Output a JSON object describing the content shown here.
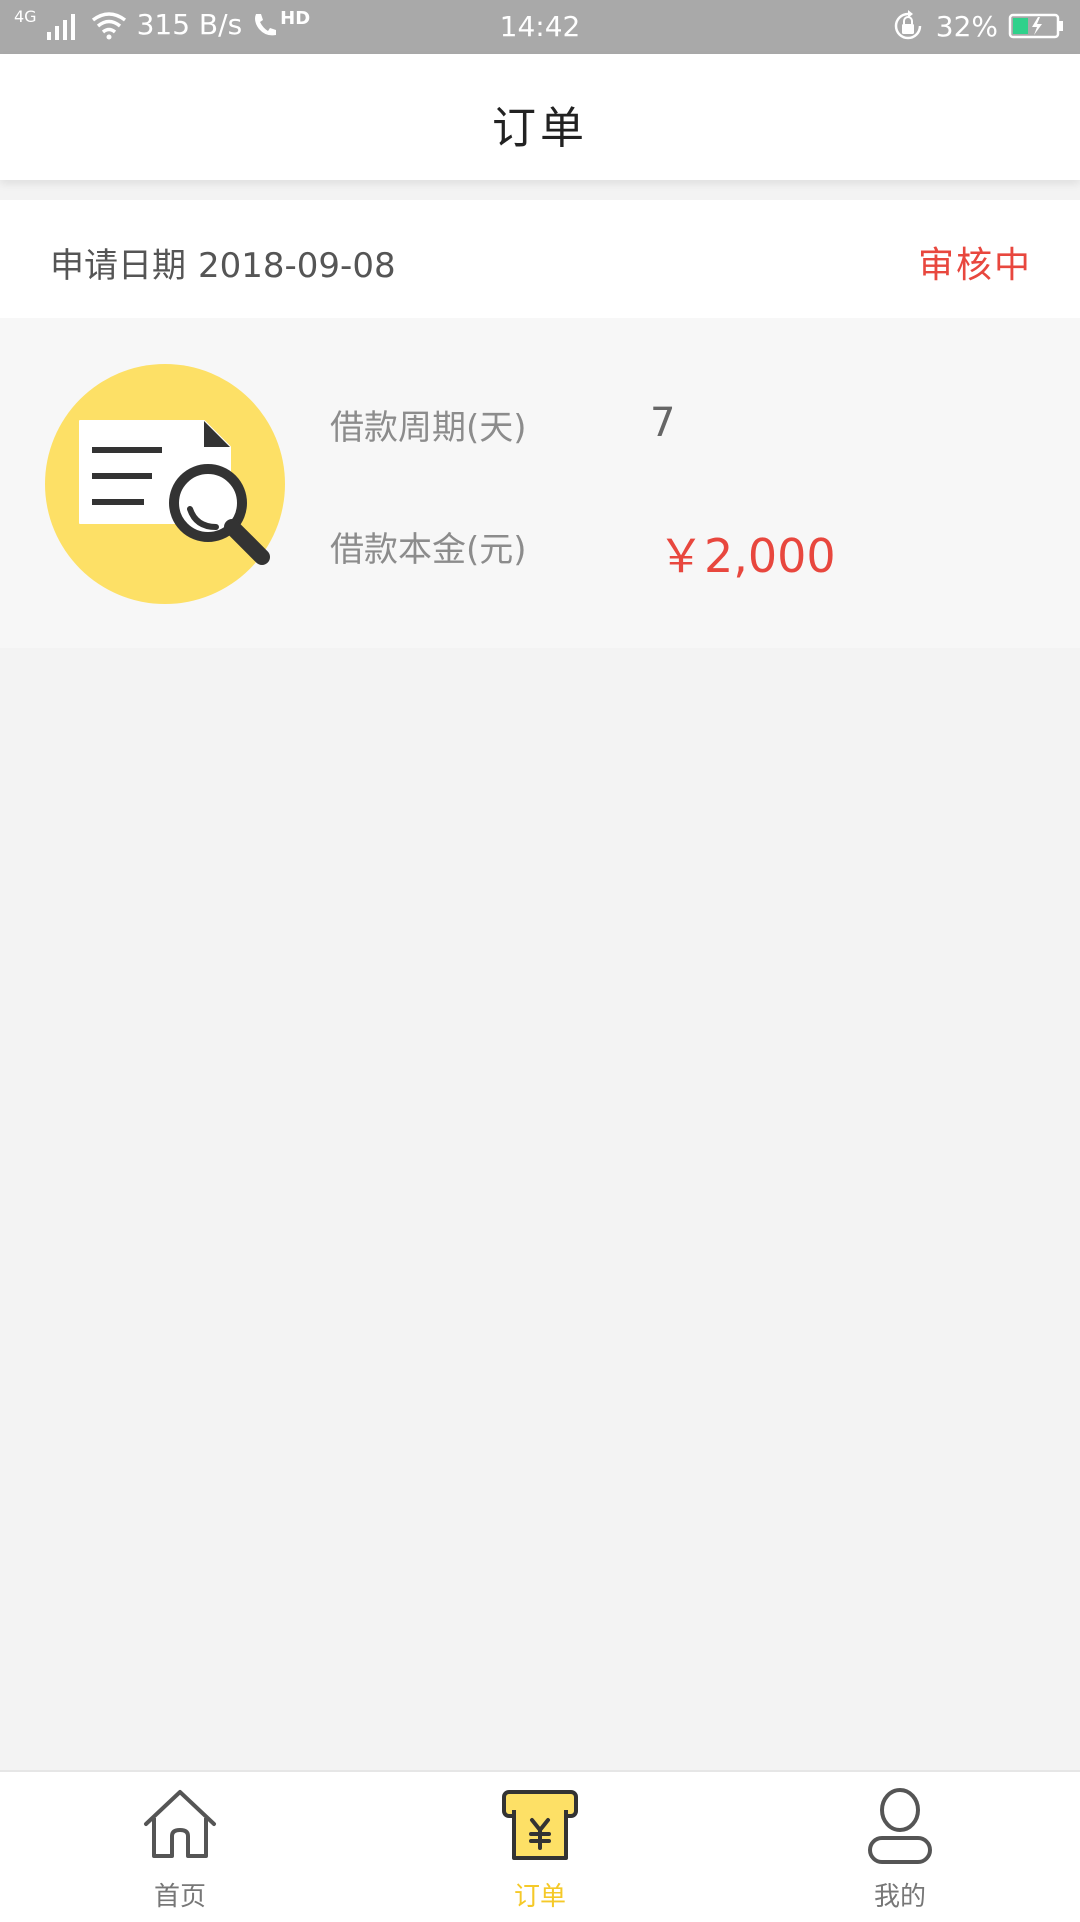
{
  "statusbar": {
    "network": "4G",
    "speed": "315 B/s",
    "hd": "HD",
    "time": "14:42",
    "battery": "32%"
  },
  "header": {
    "title": "订单"
  },
  "order": {
    "date_label": "申请日期",
    "date_value": "2018-09-08",
    "status": "审核中",
    "period_label": "借款周期(天)",
    "period_value": "7",
    "amount_label": "借款本金(元)",
    "amount_value": "￥2,000"
  },
  "tabbar": {
    "items": [
      {
        "label": "首页",
        "icon": "home-icon"
      },
      {
        "label": "订单",
        "icon": "order-icon",
        "active": true
      },
      {
        "label": "我的",
        "icon": "user-icon"
      }
    ]
  },
  "colors": {
    "accent_yellow": "#f5c928",
    "status_red": "#e8473e",
    "statusbar_gray": "#a9a9a9"
  }
}
